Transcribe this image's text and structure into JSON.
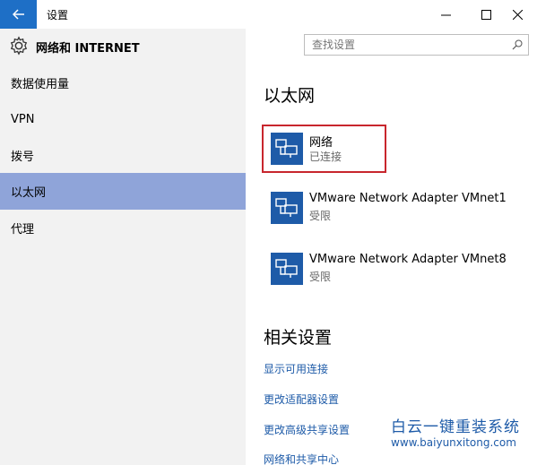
{
  "window": {
    "title": "设置",
    "back_icon": "back-arrow-icon",
    "accent": "#1e6fc6"
  },
  "header": {
    "section_title": "网络和 INTERNET",
    "gear_icon": "gear-icon",
    "search_placeholder": "查找设置"
  },
  "sidebar": {
    "items": [
      {
        "label": "数据使用量"
      },
      {
        "label": "VPN"
      },
      {
        "label": "拨号"
      },
      {
        "label": "以太网"
      },
      {
        "label": "代理"
      }
    ],
    "active_index": 3,
    "active_color": "#8fa4d9"
  },
  "main": {
    "heading": "以太网",
    "networks": [
      {
        "name": "网络",
        "status": "已连接"
      },
      {
        "name": "VMware Network Adapter VMnet1",
        "status": "受限"
      },
      {
        "name": "VMware Network Adapter VMnet8",
        "status": "受限"
      }
    ],
    "related_heading": "相关设置",
    "links": [
      {
        "label": "显示可用连接"
      },
      {
        "label": "更改适配器设置"
      },
      {
        "label": "更改高级共享设置"
      },
      {
        "label": "网络和共享中心"
      }
    ]
  },
  "watermark": {
    "title": "白云一键重装系统",
    "url": "www.baiyunxitong.com"
  }
}
